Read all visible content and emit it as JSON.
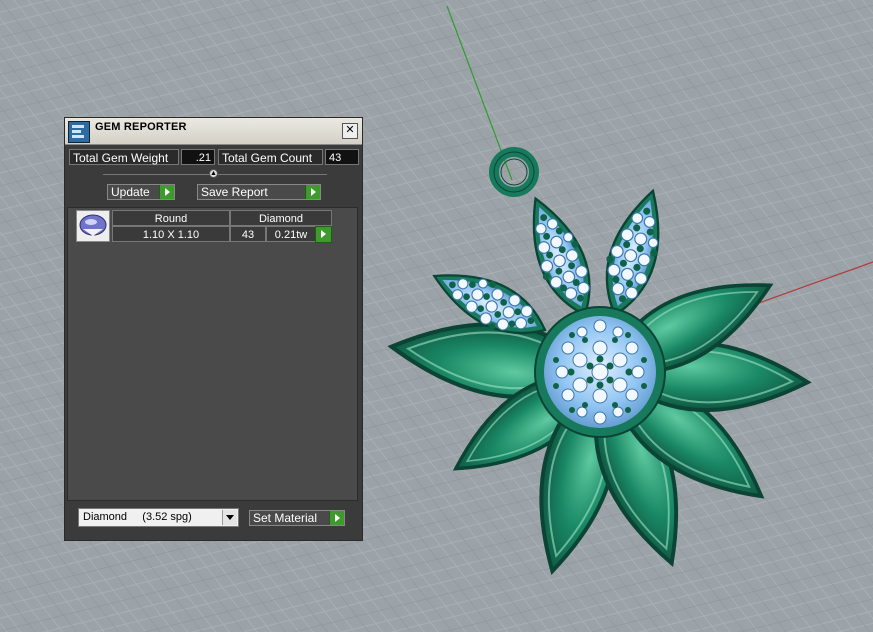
{
  "window": {
    "title": "GEM REPORTER",
    "close_glyph": "✕"
  },
  "summary": {
    "weight_label": "Total Gem Weight",
    "weight_value": ".21",
    "count_label": "Total Gem Count",
    "count_value": "43"
  },
  "toolbar": {
    "update_label": "Update",
    "save_report_label": "Save Report"
  },
  "report": {
    "rows": [
      {
        "shape": "Round",
        "material": "Diamond",
        "size": "1.10 X 1.10",
        "count": "43",
        "weight": "0.21tw"
      }
    ]
  },
  "footer": {
    "material_selected": "Diamond     (3.52 spg)",
    "set_material_label": "Set Material"
  },
  "colors": {
    "model_green": "#187a5c",
    "gem_blue": "#8fc4f2",
    "axis_green": "#2f9c2f",
    "axis_red": "#b23a3a",
    "grid_bg": "#9ca3a8"
  }
}
